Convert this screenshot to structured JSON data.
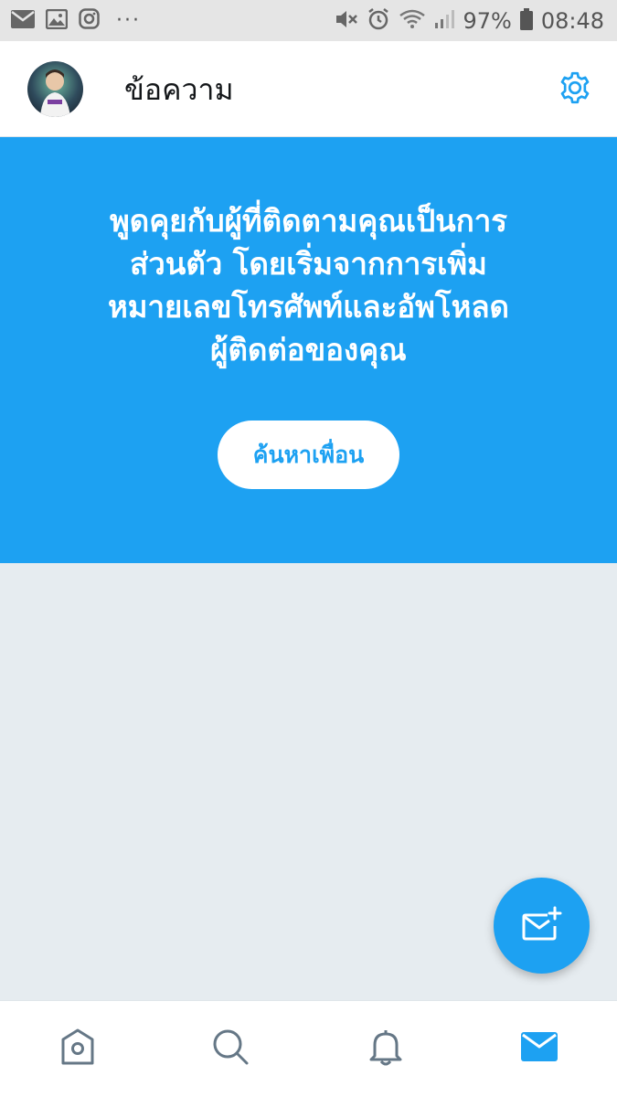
{
  "status_bar": {
    "battery_percent": "97%",
    "time": "08:48",
    "more_indicator": "···",
    "left_icons": [
      "mail-icon",
      "image-icon",
      "instagram-icon"
    ],
    "right_icons": [
      "mute-icon",
      "alarm-icon",
      "wifi-icon",
      "signal-icon",
      "battery-icon"
    ]
  },
  "header": {
    "title": "ข้อความ",
    "avatar_icon": "avatar",
    "settings_icon": "gear-icon"
  },
  "promo": {
    "message": "พูดคุยกับผู้ที่ติดตามคุณเป็นการส่วนตัว โดยเริ่มจากการเพิ่มหมายเลขโทรศัพท์และอัพโหลดผู้ติดต่อของคุณ",
    "lines": [
      "พูดคุยกับผู้ที่ติดตามคุณเป็นการ",
      "ส่วนตัว โดยเริ่มจากการเพิ่ม",
      "หมายเลขโทรศัพท์และอัพโหลด",
      "ผู้ติดต่อของคุณ"
    ],
    "button_label": "ค้นหาเพื่อน"
  },
  "fab": {
    "icon": "new-message-icon"
  },
  "bottom_nav": {
    "items": [
      {
        "icon": "home-icon",
        "active": false
      },
      {
        "icon": "search-icon",
        "active": false
      },
      {
        "icon": "bell-icon",
        "active": false
      },
      {
        "icon": "mail-icon",
        "active": true
      }
    ]
  },
  "colors": {
    "accent": "#1da1f2",
    "background": "#e6ecf0",
    "header_bg": "#ffffff",
    "status_bar_bg": "#e5e5e5",
    "icon_inactive": "#657786",
    "text_primary": "#14171a"
  }
}
